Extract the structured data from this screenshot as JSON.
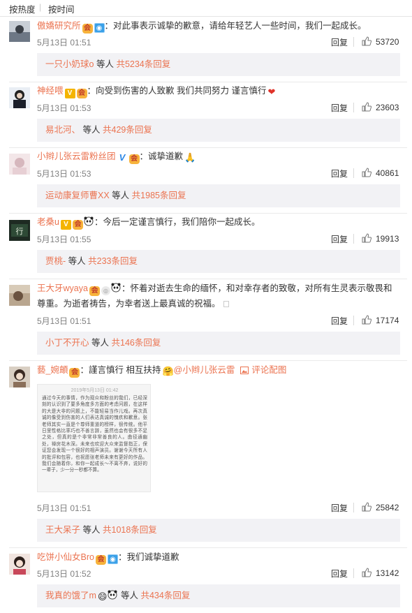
{
  "tabs": [
    {
      "label": "按热度",
      "active": true
    },
    {
      "label": "按时间",
      "active": false
    }
  ],
  "common": {
    "reply_label": "回复",
    "others_label": "等人"
  },
  "comments": [
    {
      "user": "傲嬌研究所",
      "content": "：对此事表示诚挚的歉意，请给年轻艺人一些时间，我们一起成长。",
      "time": "5月13日 01:51",
      "likes": "53720",
      "sub_user": "一只小奶球o",
      "sub_count": "共5234条回复"
    },
    {
      "user": "神经喂",
      "content": "：向受到伤害的人致歉 我们共同努力 谨言慎行",
      "time": "5月13日 01:53",
      "likes": "23603",
      "sub_user": "易北河、",
      "sub_count": "共429条回复"
    },
    {
      "user": "小辫儿张云雷粉丝团",
      "content": "：诚挚道歉",
      "time": "5月13日 01:53",
      "likes": "40861",
      "sub_user": "运动康复师曹XX",
      "sub_count": "共1985条回复"
    },
    {
      "user": "老桑u",
      "content": "：今后一定谨言慎行，我们陪你一起成长。",
      "time": "5月13日 01:55",
      "likes": "19913",
      "sub_user": "贾桃-",
      "sub_count": "共233条回复"
    },
    {
      "user": "王大牙wyaya",
      "content": "：怀着对逝去生命的缅怀，和对幸存者的致敬，对所有生灵表示敬畏和尊重。为逝者祷告，为幸者送上最真诚的祝福。",
      "time": "5月13日 01:51",
      "likes": "17174",
      "sub_user": "小丁不开心",
      "sub_count": "共146条回复"
    },
    {
      "user": "藝_婉頔",
      "content": "：謹言慎行 相互扶持",
      "mention": "@小辫儿张云雷",
      "pic_link": "评论配图",
      "attachment_date": "2019年5月13日 01:42",
      "attachment_text": "通过今天的事情，作为观众和粉丝的我们，已经深刻的认识到了要多角度多方面的考虑问题，在这样的大是大非的问题上，不能轻易当作儿戏。再次真诚的像受到伤害的人们表达真诚的愧疚和歉意。张老师其实一直是个尊师重道的榜样，很传统。他平日里性格比率巧也不善言辞，虽然也会有很多不足之处，但真的是个非常非常善良的人。曲径通幽处，禅房花木深。未来也欢迎大众来监督指正，保证您会发现一个很好的相声演员。谢谢今天所有人的批评和包容，也祝愿张老师未来有更好的作品。我们会随着你，和你一起成长～不离不弃，说好的一辈子，少一分一秒都不算。",
      "time": "5月13日 01:51",
      "likes": "25842",
      "sub_user": "王大呆子",
      "sub_count": "共1018条回复"
    },
    {
      "user": "吃饼小仙女Bro",
      "content": "：我们诚挚道歉",
      "time": "5月13日 01:52",
      "likes": "13142",
      "sub_user": "我真的饿了m",
      "sub_count": "共434条回复"
    }
  ],
  "colors": {
    "username": "#eb7350",
    "meta": "#808080",
    "sub_bg": "#f2f2f5"
  },
  "icons": [
    "member-badge-icon",
    "verified-v-icon",
    "thumbs-up-icon",
    "heart-emoji-icon",
    "panda-emoji-icon",
    "pray-emoji-icon",
    "picture-icon"
  ]
}
